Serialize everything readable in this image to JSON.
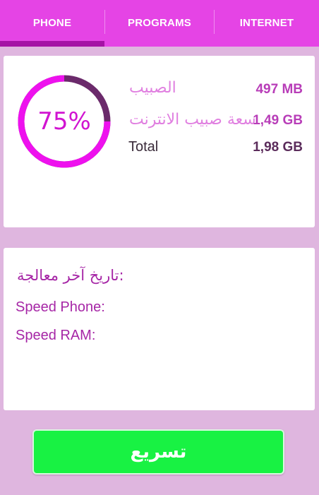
{
  "tabs": [
    {
      "label": "PHONE",
      "active": true
    },
    {
      "label": "PROGRAMS",
      "active": false
    },
    {
      "label": "INTERNET",
      "active": false
    }
  ],
  "usage": {
    "percent_label": "75%",
    "percent": 75,
    "rows": [
      {
        "name": "الصبيب",
        "value": "497 MB"
      },
      {
        "name": "سعة صبيب الانترنت",
        "value": "1,49 GB"
      },
      {
        "name": "Total",
        "value": "1,98 GB"
      }
    ]
  },
  "info": {
    "last_treatment": "تاريخ آخر معالجة:",
    "speed_phone": "Speed Phone:",
    "speed_ram": "Speed RAM:"
  },
  "boost_button": {
    "label": "تسريع"
  },
  "colors": {
    "tab_bar": "#e544e5",
    "tab_indicator": "#a512a5",
    "background": "#dfb6df",
    "ring_fill": "#ee11ee",
    "ring_track": "#6b2a6b",
    "button": "#18f243"
  }
}
